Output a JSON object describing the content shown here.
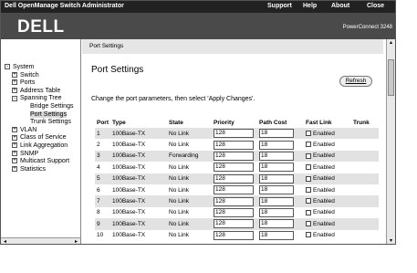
{
  "app": {
    "title": "Dell OpenManage Switch Administrator",
    "menu": [
      "Support",
      "Help",
      "About",
      "Close"
    ],
    "logo": "DELL",
    "model": "PowerConnect 3248"
  },
  "tree": [
    {
      "label": "System",
      "pm": "-",
      "indent": 0
    },
    {
      "label": "Switch",
      "pm": "+",
      "indent": 1
    },
    {
      "label": "Ports",
      "pm": "+",
      "indent": 1
    },
    {
      "label": "Address Table",
      "pm": "+",
      "indent": 1
    },
    {
      "label": "Spanning Tree",
      "pm": "-",
      "indent": 1
    },
    {
      "label": "Bridge Settings",
      "pm": "",
      "indent": 2
    },
    {
      "label": "Port Settings",
      "pm": "",
      "indent": 2,
      "selected": true
    },
    {
      "label": "Trunk Settings",
      "pm": "",
      "indent": 2
    },
    {
      "label": "VLAN",
      "pm": "+",
      "indent": 1
    },
    {
      "label": "Class of Service",
      "pm": "+",
      "indent": 1
    },
    {
      "label": "Link Aggregation",
      "pm": "+",
      "indent": 1
    },
    {
      "label": "SNMP",
      "pm": "+",
      "indent": 1
    },
    {
      "label": "Multicast Support",
      "pm": "+",
      "indent": 1
    },
    {
      "label": "Statistics",
      "pm": "+",
      "indent": 1
    }
  ],
  "breadcrumb": "Port Settings",
  "page": {
    "title": "Port Settings",
    "refresh_label": "Refresh",
    "instructions": "Change the port parameters, then select 'Apply Changes'."
  },
  "table": {
    "headers": [
      "Port",
      "Type",
      "State",
      "Priority",
      "Path Cost",
      "Fast Link",
      "Trunk"
    ],
    "checkbox_label": "Enabled",
    "rows": [
      {
        "port": "1",
        "type": "100Base-TX",
        "state": "No Link",
        "priority": "128",
        "cost": "18"
      },
      {
        "port": "2",
        "type": "100Base-TX",
        "state": "No Link",
        "priority": "128",
        "cost": "18"
      },
      {
        "port": "3",
        "type": "100Base-TX",
        "state": "Forwarding",
        "priority": "128",
        "cost": "18"
      },
      {
        "port": "4",
        "type": "100Base-TX",
        "state": "No Link",
        "priority": "128",
        "cost": "18"
      },
      {
        "port": "5",
        "type": "100Base-TX",
        "state": "No Link",
        "priority": "128",
        "cost": "18"
      },
      {
        "port": "6",
        "type": "100Base-TX",
        "state": "No Link",
        "priority": "128",
        "cost": "18"
      },
      {
        "port": "7",
        "type": "100Base-TX",
        "state": "No Link",
        "priority": "128",
        "cost": "18"
      },
      {
        "port": "8",
        "type": "100Base-TX",
        "state": "No Link",
        "priority": "128",
        "cost": "18"
      },
      {
        "port": "9",
        "type": "100Base-TX",
        "state": "No Link",
        "priority": "128",
        "cost": "18"
      },
      {
        "port": "10",
        "type": "100Base-TX",
        "state": "No Link",
        "priority": "128",
        "cost": "18"
      }
    ]
  }
}
